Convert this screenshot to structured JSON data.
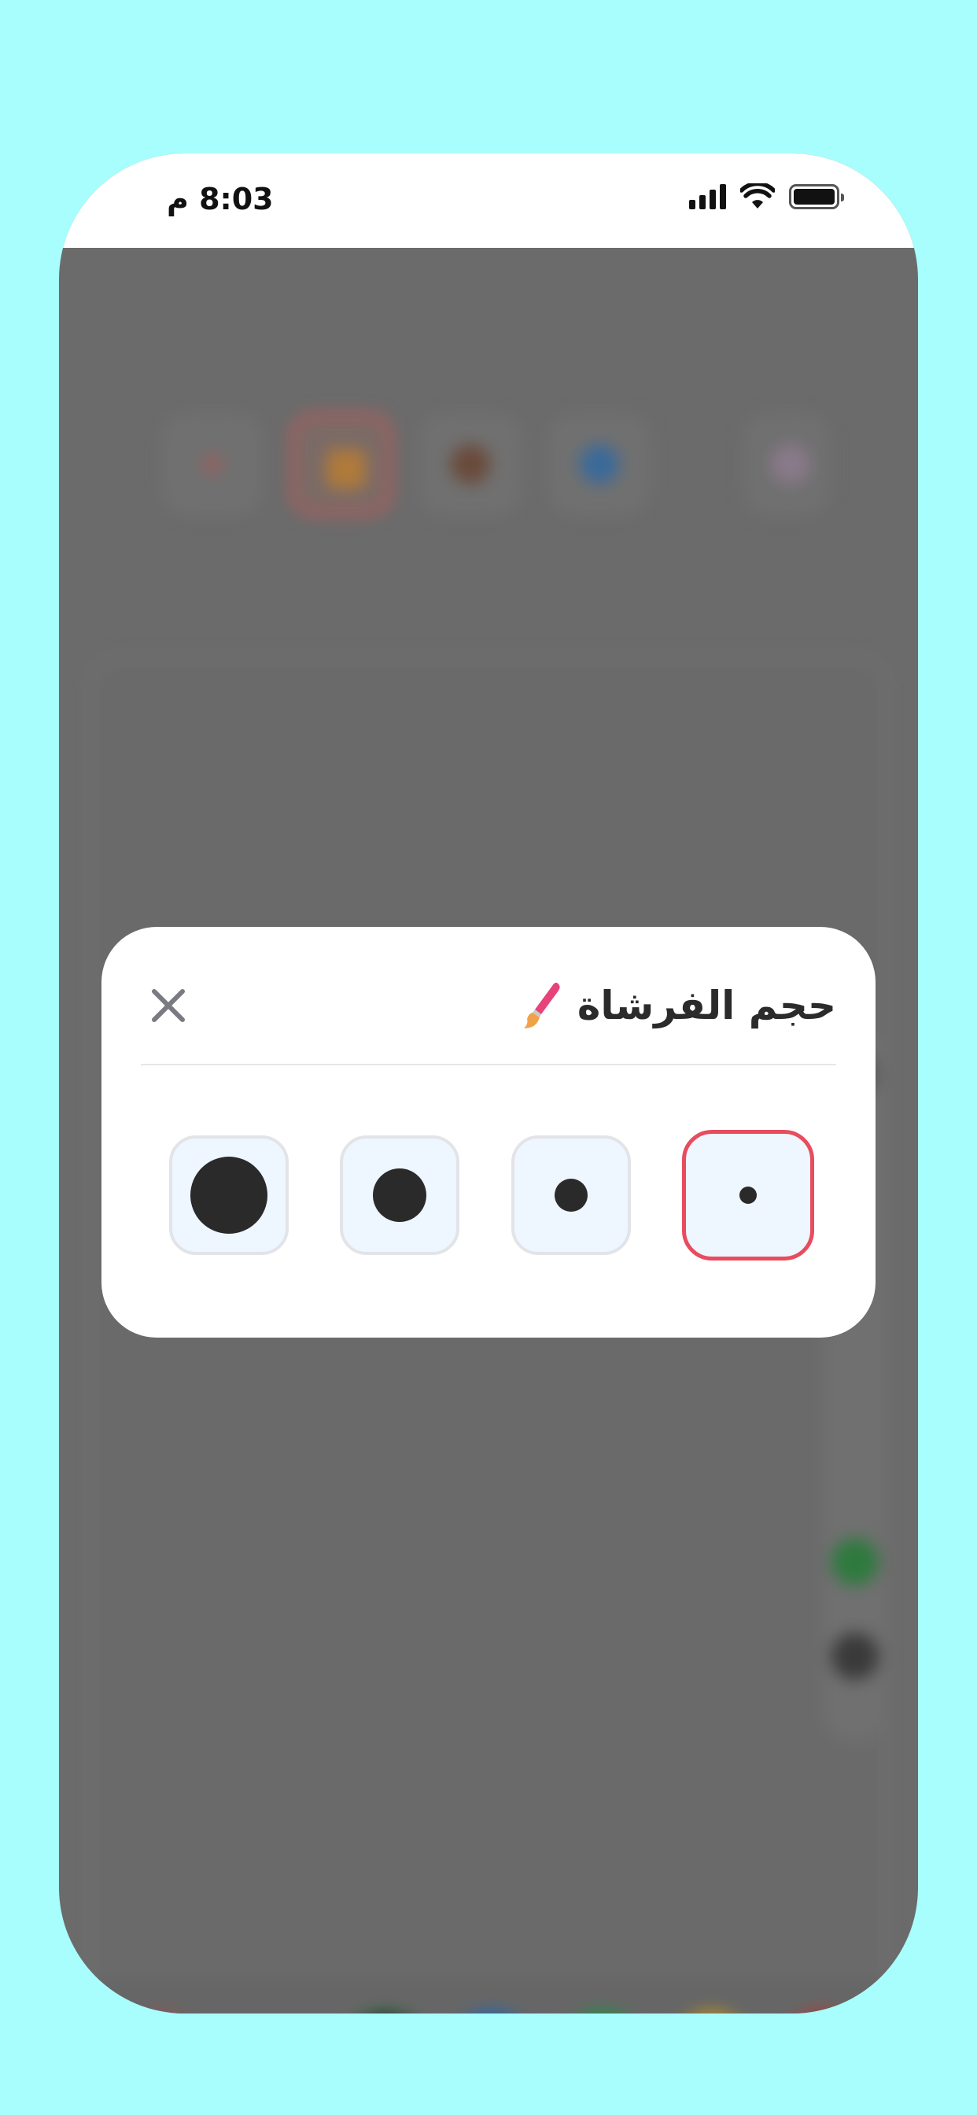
{
  "status_bar": {
    "time": "8:03 م"
  },
  "modal": {
    "title": "حجم الفرشاة",
    "title_icon": "paintbrush-icon",
    "close_icon": "close-icon",
    "brush_sizes": [
      {
        "name": "extra-large",
        "selected": false
      },
      {
        "name": "large",
        "selected": false
      },
      {
        "name": "medium",
        "selected": false
      },
      {
        "name": "small",
        "selected": true
      }
    ]
  },
  "colors": {
    "page_background": "#a8fefd",
    "accent_selected": "#e84c5f",
    "option_background": "#eef6ff",
    "dot": "#2a2a2a"
  }
}
